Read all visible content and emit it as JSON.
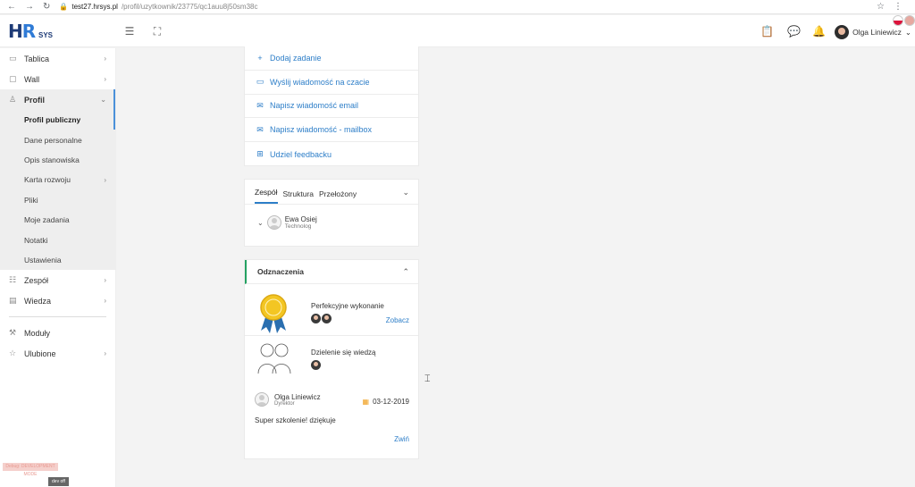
{
  "browser": {
    "url_host": "test27.hrsys.pl",
    "url_path": "/profil/uzytkownik/23775/qc1auu8j50sm38c",
    "back_icon": "back-arrow-icon",
    "forward_icon": "forward-arrow-icon",
    "reload_icon": "reload-icon"
  },
  "header": {
    "logo_hr": "HR",
    "logo_sys": "SYS",
    "user_name": "Olga Liniewicz",
    "languages": [
      "pl",
      "en"
    ]
  },
  "sidebar": {
    "items": [
      {
        "label": "Tablica",
        "icon": "monitor-icon",
        "chevron": true
      },
      {
        "label": "Wall",
        "icon": "chat-icon",
        "chevron": true
      },
      {
        "label": "Profil",
        "icon": "user-icon",
        "chevron": true,
        "active": true
      }
    ],
    "profil_sub": [
      {
        "label": "Profil publiczny",
        "active": true
      },
      {
        "label": "Dane personalne"
      },
      {
        "label": "Opis stanowiska"
      },
      {
        "label": "Karta rozwoju",
        "chevron": true
      },
      {
        "label": "Pliki"
      },
      {
        "label": "Moje zadania"
      },
      {
        "label": "Notatki"
      },
      {
        "label": "Ustawienia"
      }
    ],
    "items_after": [
      {
        "label": "Zespół",
        "icon": "team-icon",
        "chevron": true
      },
      {
        "label": "Wiedza",
        "icon": "book-icon",
        "chevron": true
      }
    ],
    "items_bottom": [
      {
        "label": "Moduły",
        "icon": "wrench-icon"
      },
      {
        "label": "Ulubione",
        "icon": "star-icon",
        "chevron": true
      }
    ],
    "dev_label": "dev off",
    "debug_label": "Debug: DEVELOPMENT MODE"
  },
  "actions": [
    {
      "label": "Dodaj zadanie",
      "icon": "plus-icon"
    },
    {
      "label": "Wyślij wiadomość na czacie",
      "icon": "chat-icon"
    },
    {
      "label": "Napisz wiadomość email",
      "icon": "envelope-icon"
    },
    {
      "label": "Napisz wiadomość - mailbox",
      "icon": "envelope-icon"
    },
    {
      "label": "Udziel feedbacku",
      "icon": "plus-square-icon"
    }
  ],
  "team": {
    "tabs": [
      "Zespół",
      "Struktura",
      "Przełożony"
    ],
    "active_tab": "Zespół",
    "member_name": "Ewa Osiej",
    "member_role": "Technolog"
  },
  "awards": {
    "title": "Odznaczenia",
    "items": [
      {
        "title": "Perfekcyjne wykonanie",
        "link": "Zobacz",
        "icon": "medal-icon"
      },
      {
        "title": "Dzielenie się wiedzą",
        "icon": "people-icon"
      }
    ],
    "comment_author": "Olga Liniewicz",
    "comment_role": "Dyrektor",
    "comment_date": "03-12-2019",
    "comment_text": "Super szkolenie! dziękuje",
    "collapse_link": "Zwiń"
  }
}
